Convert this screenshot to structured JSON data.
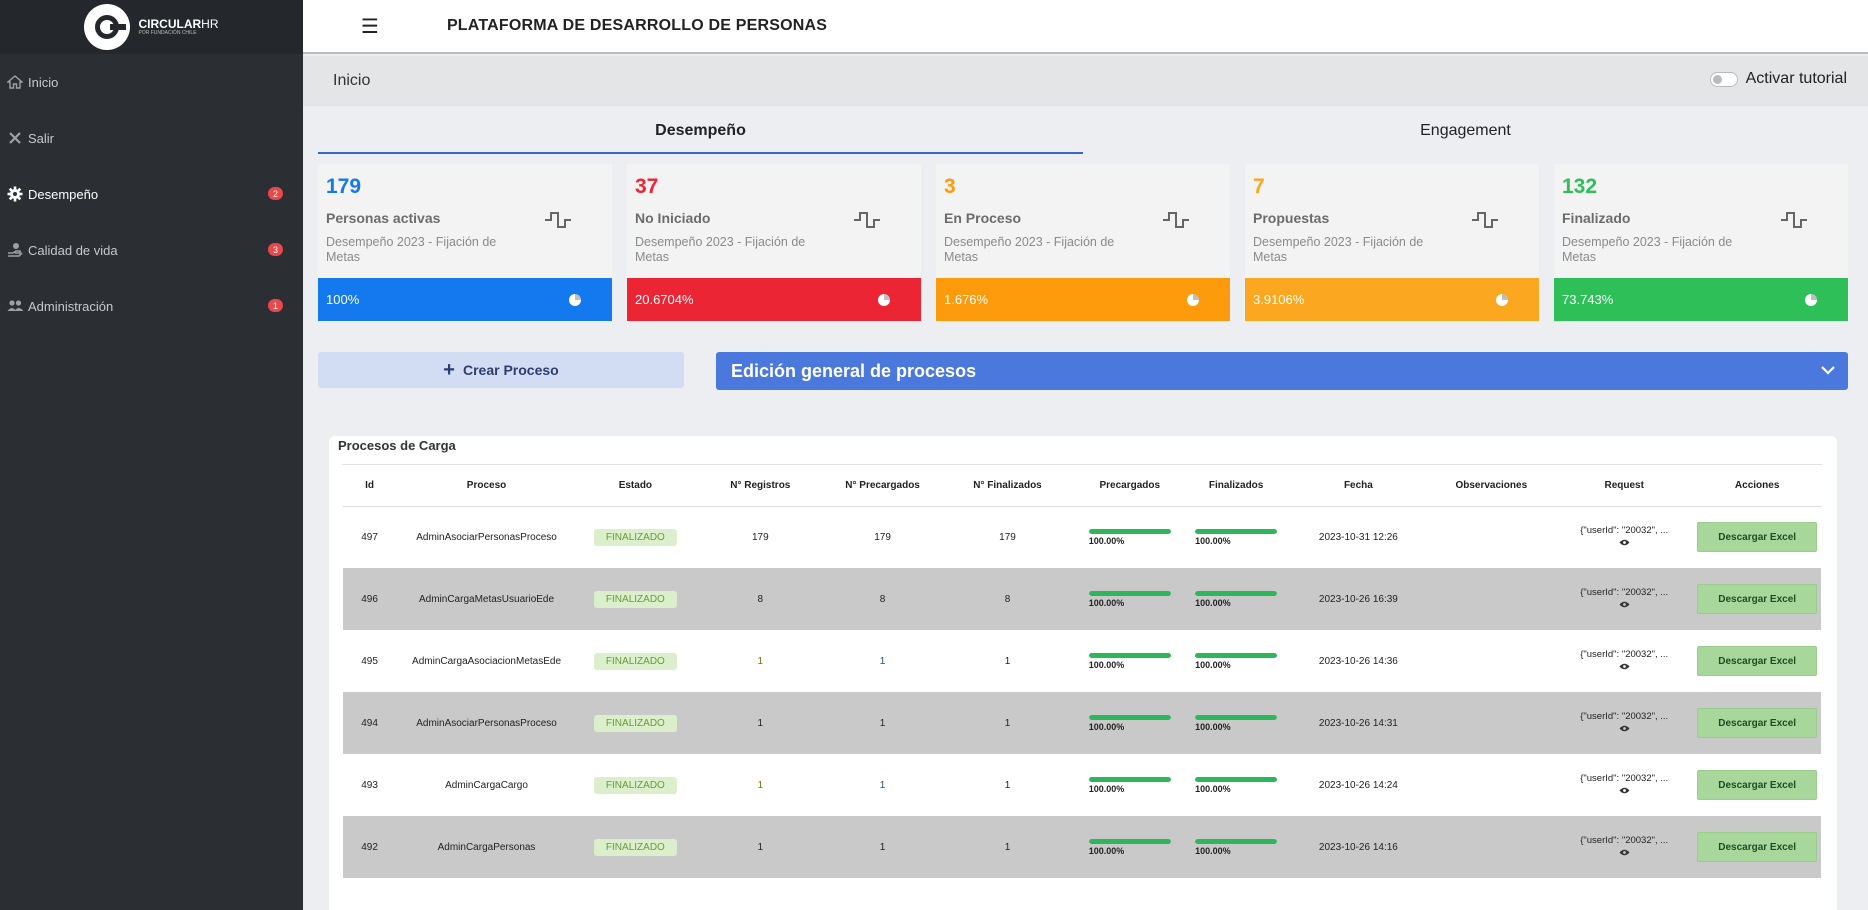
{
  "brand": {
    "name": "CIRCULAR",
    "name_suffix": "HR",
    "tagline": "POR FUNDACIÓN CHILE"
  },
  "app_title": "PLATAFORMA DE DESARROLLO DE PERSONAS",
  "sidebar": {
    "items": [
      {
        "label": "Inicio",
        "icon": "home-icon"
      },
      {
        "label": "Salir",
        "icon": "close-icon"
      },
      {
        "label": "Desempeño",
        "icon": "gear-icon",
        "badge": "2",
        "active": true
      },
      {
        "label": "Calidad de vida",
        "icon": "user-hand-icon",
        "badge": "3"
      },
      {
        "label": "Administración",
        "icon": "users-icon",
        "badge": "1"
      }
    ]
  },
  "breadcrumb": "Inicio",
  "tutorial_label": "Activar tutorial",
  "tabs": [
    {
      "label": "Desempeño"
    },
    {
      "label": "Engagement"
    }
  ],
  "cards": [
    {
      "value": "179",
      "label": "Personas activas",
      "sub": "Desempeño 2023 - Fijación de Metas",
      "percent": "100%",
      "color": "#1479ef"
    },
    {
      "value": "37",
      "label": "No Iniciado",
      "sub": "Desempeño 2023 - Fijación de Metas",
      "percent": "20.6704%",
      "color": "#ec2534"
    },
    {
      "value": "3",
      "label": "En Proceso",
      "sub": "Desempeño 2023 - Fijación de Metas",
      "percent": "1.676%",
      "color": "#fd9b0c"
    },
    {
      "value": "7",
      "label": "Propuestas",
      "sub": "Desempeño 2023 - Fijación de Metas",
      "percent": "3.9106%",
      "color": "#fca720"
    },
    {
      "value": "132",
      "label": "Finalizado",
      "sub": "Desempeño 2023 - Fijación de Metas",
      "percent": "73.743%",
      "color": "#2fbf58"
    }
  ],
  "crear_proceso": "Crear Proceso",
  "edicion_general": "Edición general de procesos",
  "table": {
    "title": "Procesos de Carga",
    "headers": [
      "Id",
      "Proceso",
      "Estado",
      "N° Registros",
      "N° Precargados",
      "N° Finalizados",
      "Precargados",
      "Finalizados",
      "Fecha",
      "Observaciones",
      "Request",
      "Acciones"
    ],
    "rows": [
      {
        "id": "497",
        "proceso": "AdminAsociarPersonasProceso",
        "estado": "FINALIZADO",
        "registros": "179",
        "precargados": "179",
        "finalizados": "179",
        "pre_pct": "100.00%",
        "pre_frac": 1.0,
        "fin_pct": "100.00%",
        "fin_frac": 1.0,
        "fecha": "2023-10-31 12:26",
        "observaciones": "",
        "request": "{\"userId\": \"20032\", ...",
        "accion": "Descargar Excel"
      },
      {
        "id": "496",
        "proceso": "AdminCargaMetasUsuarioEde",
        "estado": "FINALIZADO",
        "registros": "8",
        "precargados": "8",
        "finalizados": "8",
        "pre_pct": "100.00%",
        "pre_frac": 1.0,
        "fin_pct": "100.00%",
        "fin_frac": 1.0,
        "fecha": "2023-10-26 16:39",
        "observaciones": "",
        "request": "{\"userId\": \"20032\", ...",
        "accion": "Descargar Excel"
      },
      {
        "id": "495",
        "proceso": "AdminCargaAsociacionMetasEde",
        "estado": "FINALIZADO",
        "registros": "1",
        "precargados": "1",
        "finalizados": "1",
        "pre_pct": "100.00%",
        "pre_frac": 1.0,
        "fin_pct": "100.00%",
        "fin_frac": 1.0,
        "fecha": "2023-10-26 14:36",
        "observaciones": "",
        "request": "{\"userId\": \"20032\", ...",
        "accion": "Descargar Excel"
      },
      {
        "id": "494",
        "proceso": "AdminAsociarPersonasProceso",
        "estado": "FINALIZADO",
        "registros": "1",
        "precargados": "1",
        "finalizados": "1",
        "pre_pct": "100.00%",
        "pre_frac": 1.0,
        "fin_pct": "100.00%",
        "fin_frac": 1.0,
        "fecha": "2023-10-26 14:31",
        "observaciones": "",
        "request": "{\"userId\": \"20032\", ...",
        "accion": "Descargar Excel"
      },
      {
        "id": "493",
        "proceso": "AdminCargaCargo",
        "estado": "FINALIZADO",
        "registros": "1",
        "precargados": "1",
        "finalizados": "1",
        "pre_pct": "100.00%",
        "pre_frac": 1.0,
        "fin_pct": "100.00%",
        "fin_frac": 1.0,
        "fecha": "2023-10-26 14:24",
        "observaciones": "",
        "request": "{\"userId\": \"20032\", ...",
        "accion": "Descargar Excel"
      },
      {
        "id": "492",
        "proceso": "AdminCargaPersonas",
        "estado": "FINALIZADO",
        "registros": "1",
        "precargados": "1",
        "finalizados": "1",
        "pre_pct": "100.00%",
        "pre_frac": 1.0,
        "fin_pct": "100.00%",
        "fin_frac": 1.0,
        "fecha": "2023-10-26 14:16",
        "observaciones": "",
        "request": "{\"userId\": \"20032\", ...",
        "accion": "Descargar Excel"
      }
    ]
  }
}
